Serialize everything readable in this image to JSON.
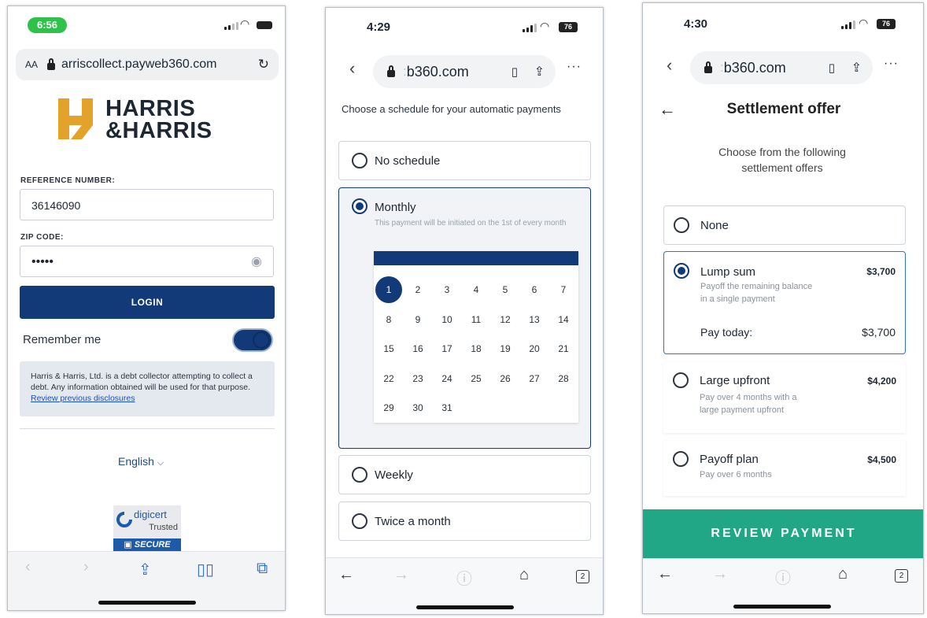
{
  "screen1": {
    "status_time": "6:56",
    "url_aa": "AA",
    "url": "arriscollect.payweb360.com",
    "logo_line1": "HARRIS",
    "logo_line2": "&HARRIS",
    "ref_label": "REFERENCE NUMBER:",
    "ref_value": "36146090",
    "zip_label": "ZIP CODE:",
    "zip_value": "•••••",
    "login_label": "LOGIN",
    "remember_label": "Remember me",
    "disclaimer": "Harris & Harris, Ltd. is a debt collector attempting to collect a debt. Any information obtained will be used for that purpose.",
    "disclaimer_link": "Review previous disclosures",
    "language": "English",
    "badge_line1": "digicert",
    "badge_line2": "Trusted",
    "badge_line3": "SECURE"
  },
  "screen2": {
    "status_time": "4:29",
    "battery": "76",
    "url": "b360.com",
    "heading": "Choose a schedule for your automatic payments",
    "options": [
      {
        "label": "No schedule"
      },
      {
        "label": "Monthly",
        "desc": "This payment will be initiated on the 1st of every month"
      },
      {
        "label": "Weekly"
      },
      {
        "label": "Twice a month"
      }
    ],
    "calendar_days": [
      "1",
      "2",
      "3",
      "4",
      "5",
      "6",
      "7",
      "8",
      "9",
      "10",
      "11",
      "12",
      "13",
      "14",
      "15",
      "16",
      "17",
      "18",
      "19",
      "20",
      "21",
      "22",
      "23",
      "24",
      "25",
      "26",
      "27",
      "28",
      "29",
      "30",
      "31"
    ],
    "tab_count": "2"
  },
  "screen3": {
    "status_time": "4:30",
    "battery": "76",
    "url": "b360.com",
    "title": "Settlement offer",
    "subtitle_line1": "Choose from the following",
    "subtitle_line2": "settlement offers",
    "options": [
      {
        "label": "None"
      },
      {
        "label": "Lump sum",
        "amount": "$3,700",
        "desc_line1": "Payoff the remaining balance",
        "desc_line2": "in a single payment",
        "pay_today_label": "Pay today:",
        "pay_today_amount": "$3,700"
      },
      {
        "label": "Large upfront",
        "amount": "$4,200",
        "desc_line1": "Pay over 4 months with a",
        "desc_line2": "large payment upfront"
      },
      {
        "label": "Payoff plan",
        "amount": "$4,500",
        "desc_line1": "Pay over 6 months"
      }
    ],
    "review_button": "REVIEW PAYMENT",
    "tab_count": "2"
  },
  "colors": {
    "navy": "#123a78",
    "teal": "#22a786",
    "logo_gold": "#e3a22a"
  }
}
